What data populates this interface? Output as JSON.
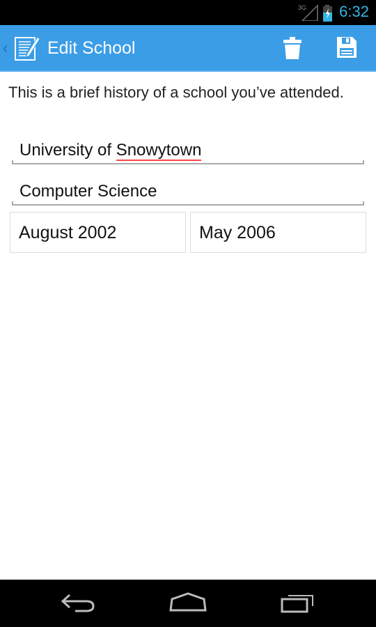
{
  "status_bar": {
    "network": "3G",
    "time": "6:32",
    "time_color": "#33b5e5"
  },
  "action_bar": {
    "title": "Edit School",
    "color": "#3b9de6",
    "back_glyph": "‹",
    "actions": [
      "trash-icon",
      "save-icon"
    ]
  },
  "form": {
    "intro": "This is a brief history of a school you’ve attended.",
    "school_prefix": "University of ",
    "school_misspelled": "Snowytown",
    "major": "Computer Science",
    "start_date": "August 2002",
    "end_date": "May 2006"
  },
  "nav_bar": [
    "back-icon",
    "home-icon",
    "recents-icon"
  ]
}
